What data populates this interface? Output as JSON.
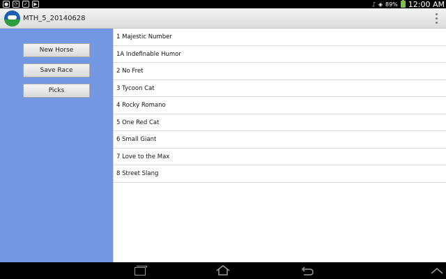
{
  "status_bar": {
    "battery": "89%",
    "time": "12:00 AM"
  },
  "action_bar": {
    "title": "MTH_5_20140628"
  },
  "sidebar": {
    "buttons": [
      "New Horse",
      "Save Race",
      "Picks"
    ]
  },
  "horses": [
    "1 Majestic Number",
    "1A Indefinable Humor",
    "2 No Fret",
    "3 Tycoon Cat",
    "4 Rocky Romano",
    "5 One Red Cat",
    "6 Small Giant",
    "7 Love to the Max",
    "8 Street Slang"
  ],
  "colors": {
    "sidebar_bg": "#7397e2",
    "battery": "#7ec242"
  }
}
